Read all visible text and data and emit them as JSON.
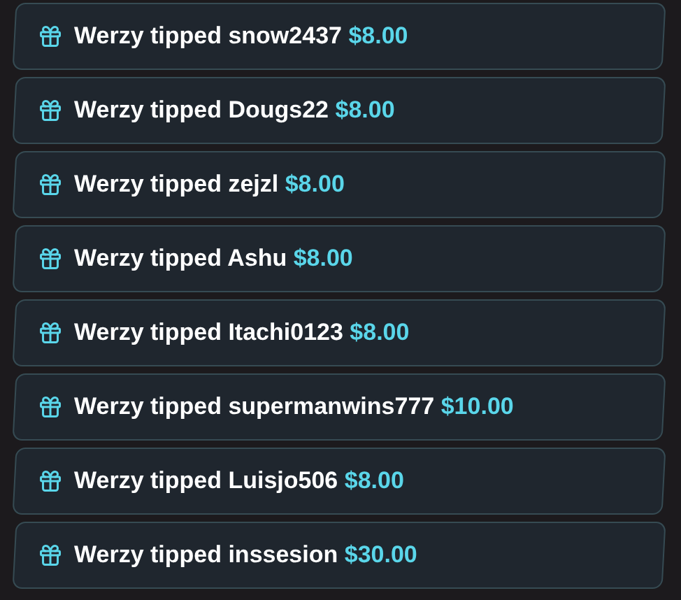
{
  "tips": [
    {
      "message": "Werzy tipped snow2437",
      "amount": "$8.00"
    },
    {
      "message": "Werzy tipped Dougs22",
      "amount": "$8.00"
    },
    {
      "message": "Werzy tipped zejzl",
      "amount": "$8.00"
    },
    {
      "message": "Werzy tipped Ashu",
      "amount": "$8.00"
    },
    {
      "message": "Werzy tipped Itachi0123",
      "amount": "$8.00"
    },
    {
      "message": "Werzy tipped supermanwins777",
      "amount": "$10.00"
    },
    {
      "message": "Werzy tipped Luisjo506",
      "amount": "$8.00"
    },
    {
      "message": "Werzy tipped inssesion",
      "amount": "$30.00"
    }
  ]
}
